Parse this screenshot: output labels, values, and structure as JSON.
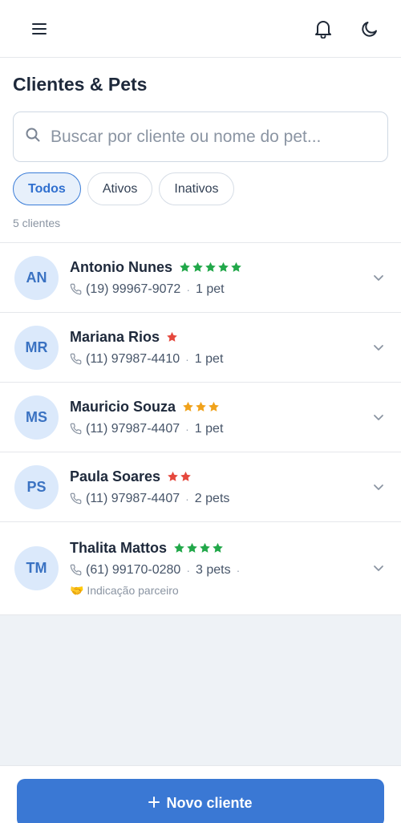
{
  "header": {
    "title": "Clientes & Pets",
    "search_placeholder": "Buscar por cliente ou nome do pet...",
    "filters": [
      {
        "label": "Todos",
        "active": true
      },
      {
        "label": "Ativos",
        "active": false
      },
      {
        "label": "Inativos",
        "active": false
      }
    ],
    "count_text": "5 clientes"
  },
  "clients": [
    {
      "initials": "AN",
      "name": "Antonio Nunes",
      "stars": 5,
      "star_color": "#22a84a",
      "phone": "(19) 99967-9072",
      "pets": "1 pet",
      "note": ""
    },
    {
      "initials": "MR",
      "name": "Mariana Rios",
      "stars": 1,
      "star_color": "#e5483d",
      "phone": "(11) 97987-4410",
      "pets": "1 pet",
      "note": ""
    },
    {
      "initials": "MS",
      "name": "Mauricio Souza",
      "stars": 3,
      "star_color": "#f0a21b",
      "phone": "(11) 97987-4407",
      "pets": "1 pet",
      "note": ""
    },
    {
      "initials": "PS",
      "name": "Paula Soares",
      "stars": 2,
      "star_color": "#e5483d",
      "phone": "(11) 97987-4407",
      "pets": "2 pets",
      "note": ""
    },
    {
      "initials": "TM",
      "name": "Thalita Mattos",
      "stars": 4,
      "star_color": "#22a84a",
      "phone": "(61) 99170-0280",
      "pets": "3 pets",
      "note": "🤝 Indicação parceiro"
    }
  ],
  "footer": {
    "button_label": "Novo cliente",
    "accent": "#3a78d4"
  },
  "icons": {
    "menu": "menu-icon",
    "bell": "bell-icon",
    "theme": "moon-icon",
    "search": "search-icon",
    "phone": "phone-icon",
    "chevron": "chevron-down-icon",
    "plus": "plus-icon"
  }
}
